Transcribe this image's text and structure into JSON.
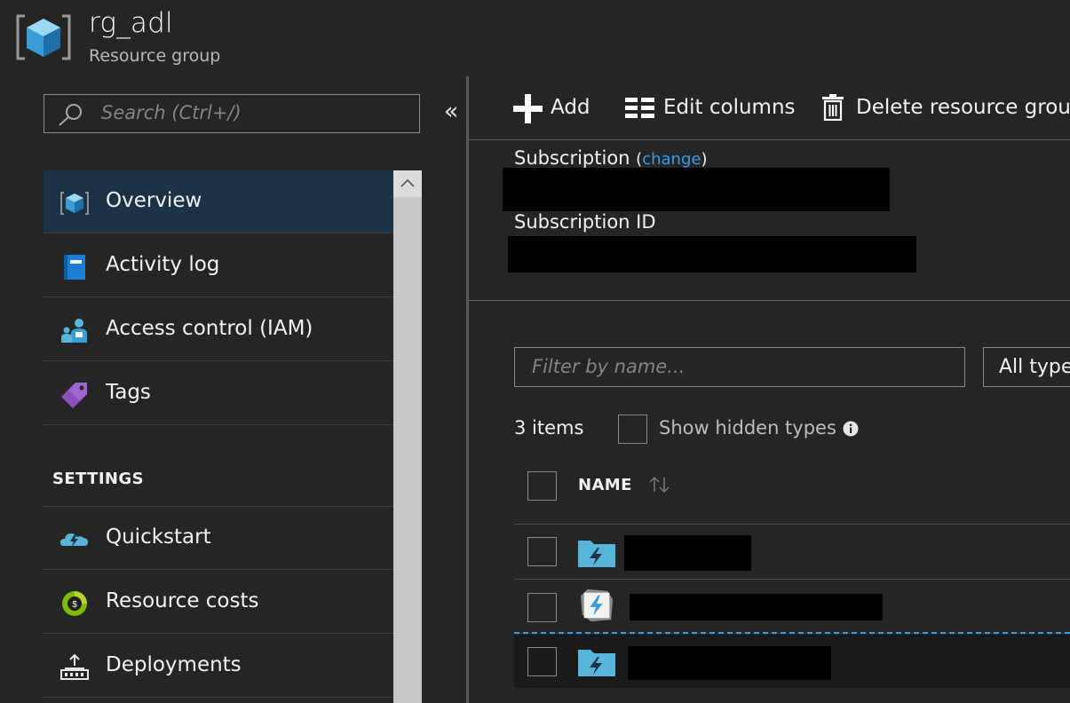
{
  "header": {
    "title": "rg_adl",
    "subtitle": "Resource group",
    "icon": "resource-group-cube-icon"
  },
  "sidebar": {
    "search_placeholder": "Search (Ctrl+/)",
    "collapse_glyph": "«",
    "items": [
      {
        "label": "Overview",
        "icon": "overview-cube-icon",
        "active": true
      },
      {
        "label": "Activity log",
        "icon": "activity-log-book-icon"
      },
      {
        "label": "Access control (IAM)",
        "icon": "access-control-people-icon"
      },
      {
        "label": "Tags",
        "icon": "tag-icon"
      }
    ],
    "settings_header": "SETTINGS",
    "settings_items": [
      {
        "label": "Quickstart",
        "icon": "quickstart-cloud-icon"
      },
      {
        "label": "Resource costs",
        "icon": "resource-costs-coin-icon"
      },
      {
        "label": "Deployments",
        "icon": "deployments-icon"
      }
    ]
  },
  "toolbar": {
    "add_label": "Add",
    "edit_columns_label": "Edit columns",
    "delete_label": "Delete resource group"
  },
  "essentials": {
    "subscription_label": "Subscription",
    "change_link": "change",
    "subscription_id_label": "Subscription ID"
  },
  "resources": {
    "filter_placeholder": "Filter by name...",
    "type_filter_value": "All types",
    "items_count": "3 items",
    "show_hidden_label": "Show hidden types",
    "column_name": "NAME",
    "rows": [
      {
        "icon": "data-lake-analytics-folder-icon"
      },
      {
        "icon": "data-lake-store-icon"
      },
      {
        "icon": "data-lake-analytics-folder-icon"
      }
    ]
  },
  "colors": {
    "accent": "#3c9be6",
    "active_nav": "#1c3246",
    "background": "#252525"
  }
}
